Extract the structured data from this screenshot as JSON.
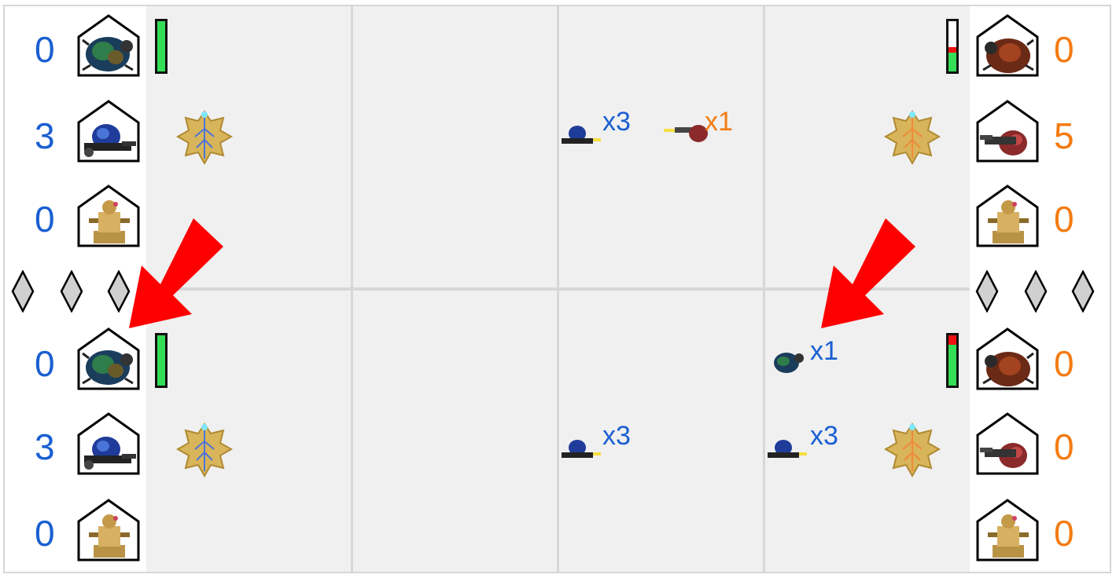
{
  "colors": {
    "blue_player": "#1a5fd1",
    "orange_player": "#f47b11",
    "hp_green": "#33dd55",
    "hp_red": "#ee1111",
    "arrow_red": "#ff0000"
  },
  "lanes": [
    {
      "name": "top",
      "left_units": [
        {
          "icon": "beetle-unit-icon",
          "count": "0"
        },
        {
          "icon": "gunner-unit-icon",
          "count": "3"
        },
        {
          "icon": "mech-unit-icon",
          "count": "0"
        }
      ],
      "right_units": [
        {
          "icon": "beetle-unit-icon",
          "count": "0"
        },
        {
          "icon": "gunner-unit-icon",
          "count": "5"
        },
        {
          "icon": "mech-unit-icon",
          "count": "0"
        }
      ],
      "left_base_hp": 1.0,
      "right_base_hp": 0.38,
      "right_base_damage": 0.1,
      "field_units": [
        {
          "side": "blue",
          "icon": "blue-gunner-icon",
          "label": "x3"
        },
        {
          "side": "orange",
          "icon": "orange-gunner-icon",
          "label": "x1"
        }
      ]
    },
    {
      "name": "bottom",
      "left_units": [
        {
          "icon": "beetle-unit-icon",
          "count": "0"
        },
        {
          "icon": "gunner-unit-icon",
          "count": "3"
        },
        {
          "icon": "mech-unit-icon",
          "count": "0"
        }
      ],
      "right_units": [
        {
          "icon": "beetle-unit-icon",
          "count": "0"
        },
        {
          "icon": "gunner-unit-icon",
          "count": "0"
        },
        {
          "icon": "mech-unit-icon",
          "count": "0"
        }
      ],
      "left_base_hp": 1.0,
      "right_base_hp": 0.82,
      "right_base_damage": 0.18,
      "field_units": [
        {
          "side": "blue",
          "icon": "blue-gunner-icon",
          "label": "x3"
        },
        {
          "side": "blue",
          "icon": "blue-beetle-icon",
          "label": "x1"
        },
        {
          "side": "blue",
          "icon": "blue-gunner-icon",
          "label": "x3"
        }
      ]
    }
  ],
  "left_diamonds": 3,
  "right_diamonds": 3,
  "arrows": [
    "left-arrow",
    "right-arrow"
  ]
}
